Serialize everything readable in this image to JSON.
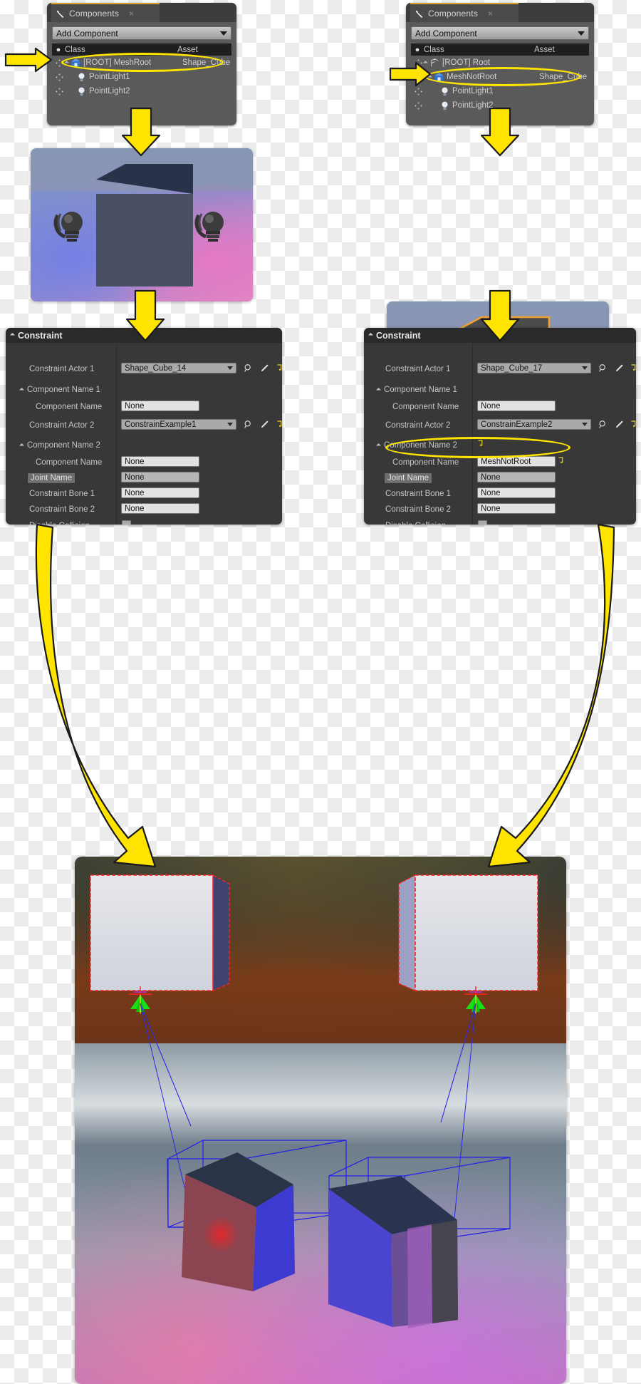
{
  "meta": {
    "accent_yellow": "#ffe400",
    "panel_bg": "#5a5a5a",
    "constraint_bg": "#383838",
    "header_bg": "#1f1f1f",
    "selection_orange": "#f0a030"
  },
  "left_components_panel": {
    "tab_label": "Components",
    "tab_icon": "wrench-icon",
    "close_label": "×",
    "add_component_label": "Add Component",
    "columns": {
      "class": "Class",
      "asset": "Asset"
    },
    "rows": [
      {
        "label": "[ROOT] MeshRoot",
        "asset": "Shape_Cube",
        "icon": "mesh-icon",
        "indent": 0,
        "highlighted": true
      },
      {
        "label": "PointLight1",
        "asset": "",
        "icon": "light-bulb-icon",
        "indent": 1,
        "highlighted": false
      },
      {
        "label": "PointLight2",
        "asset": "",
        "icon": "light-bulb-icon",
        "indent": 1,
        "highlighted": false
      }
    ]
  },
  "right_components_panel": {
    "tab_label": "Components",
    "tab_icon": "wrench-icon",
    "close_label": "×",
    "add_component_label": "Add Component",
    "columns": {
      "class": "Class",
      "asset": "Asset"
    },
    "rows": [
      {
        "label": "[ROOT] Root",
        "asset": "",
        "icon": "scene-root-icon",
        "indent": 0,
        "highlighted": false
      },
      {
        "label": "MeshNotRoot",
        "asset": "Shape_Cube",
        "icon": "mesh-icon",
        "indent": 0,
        "highlighted": true
      },
      {
        "label": "PointLight1",
        "asset": "",
        "icon": "light-bulb-icon",
        "indent": 1,
        "highlighted": false
      },
      {
        "label": "PointLight2",
        "asset": "",
        "icon": "light-bulb-icon",
        "indent": 1,
        "highlighted": false
      }
    ]
  },
  "left_constraint_panel": {
    "title": "Constraint",
    "rows": [
      {
        "label": "Constraint Actor 1",
        "value": "Shape_Cube_14",
        "type": "combo",
        "label_hl": false
      },
      {
        "label": "Component Name 1",
        "value": "",
        "type": "group",
        "label_hl": false
      },
      {
        "label": "Component Name",
        "value": "None",
        "type": "text",
        "label_hl": false
      },
      {
        "label": "Constraint Actor 2",
        "value": "ConstrainExample1",
        "type": "combo",
        "label_hl": false
      },
      {
        "label": "Component Name 2",
        "value": "",
        "type": "group",
        "label_hl": false
      },
      {
        "label": "Component Name",
        "value": "None",
        "type": "text",
        "label_hl": false
      },
      {
        "label": "Joint Name",
        "value": "None",
        "type": "text-mid",
        "label_hl": true
      },
      {
        "label": "Constraint Bone 1",
        "value": "None",
        "type": "text",
        "label_hl": false
      },
      {
        "label": "Constraint Bone 2",
        "value": "None",
        "type": "text",
        "label_hl": false
      },
      {
        "label": "Disable Collision",
        "value": "",
        "type": "checkbox",
        "label_hl": false
      }
    ]
  },
  "right_constraint_panel": {
    "title": "Constraint",
    "rows": [
      {
        "label": "Constraint Actor 1",
        "value": "Shape_Cube_17",
        "type": "combo",
        "label_hl": false
      },
      {
        "label": "Component Name 1",
        "value": "",
        "type": "group",
        "label_hl": false
      },
      {
        "label": "Component Name",
        "value": "None",
        "type": "text",
        "label_hl": false
      },
      {
        "label": "Constraint Actor 2",
        "value": "ConstrainExample2",
        "type": "combo",
        "label_hl": false
      },
      {
        "label": "Component Name 2",
        "value": "",
        "type": "group-reset",
        "label_hl": false
      },
      {
        "label": "Component Name",
        "value": "MeshNotRoot",
        "type": "text-reset",
        "label_hl": false,
        "highlighted": true
      },
      {
        "label": "Joint Name",
        "value": "None",
        "type": "text-mid",
        "label_hl": true
      },
      {
        "label": "Constraint Bone 1",
        "value": "None",
        "type": "text",
        "label_hl": false
      },
      {
        "label": "Constraint Bone 2",
        "value": "None",
        "type": "text",
        "label_hl": false
      },
      {
        "label": "Disable Collision",
        "value": "",
        "type": "checkbox",
        "label_hl": false
      }
    ]
  },
  "icons": {
    "search": "magnifier-icon",
    "picker": "eyedropper-icon",
    "reset": "reset-arrow-icon",
    "dropdown": "chevron-down-icon"
  },
  "viewports": {
    "left_thumb": {
      "name": "blueprint-viewport-left",
      "selection": "none"
    },
    "right_thumb": {
      "name": "blueprint-viewport-right",
      "selection": "orange-outline"
    },
    "main": {
      "name": "level-viewport-main"
    }
  },
  "annotations": {
    "arrow_color": "#ffe400",
    "arrow_outline": "#1a1a1a",
    "pointers": [
      "left-row-pointer",
      "right-row-pointer",
      "left-down-to-thumb",
      "right-down-to-thumb",
      "left-thumb-to-constraint",
      "right-thumb-to-constraint",
      "left-constraint-to-scene",
      "right-constraint-to-scene"
    ]
  }
}
